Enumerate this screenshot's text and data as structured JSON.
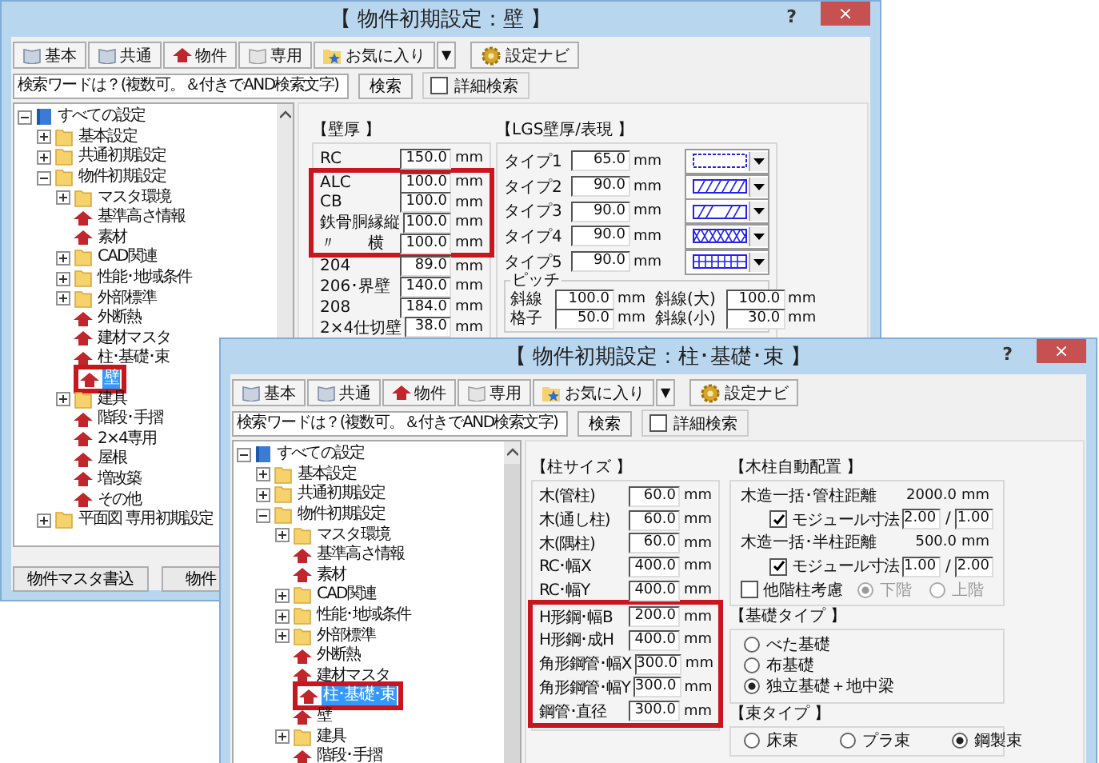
{
  "windows": [
    {
      "title": "【 物件初期設定：壁 】",
      "help": "?",
      "close": "×",
      "toolbar": [
        {
          "label": "基本"
        },
        {
          "label": "共通"
        },
        {
          "label": "物件"
        },
        {
          "label": "専用"
        },
        {
          "label": "お気に入り"
        },
        {
          "label": "▼"
        },
        {
          "label": "設定ナビ"
        }
      ],
      "search": {
        "value": "検索ワードは？(複数可。＆付きでAND検索文字)",
        "button": "検索",
        "detail": {
          "label": "詳細検索",
          "checked": false
        }
      },
      "tree": [
        {
          "label": "すべての設定",
          "kind": "root",
          "expanded": true,
          "selected": false,
          "highlighted": false,
          "children": [
            {
              "label": "基本設定",
              "kind": "folder",
              "expanded": false,
              "selected": false,
              "highlighted": false
            },
            {
              "label": "共通初期設定",
              "kind": "folder",
              "expanded": false,
              "selected": false,
              "highlighted": false
            },
            {
              "label": "物件初期設定",
              "kind": "folder",
              "expanded": true,
              "selected": false,
              "highlighted": false,
              "children": [
                {
                  "label": "マスタ環境",
                  "kind": "folder",
                  "expanded": false,
                  "selected": false,
                  "highlighted": false
                },
                {
                  "label": "基準高さ情報",
                  "kind": "page",
                  "selected": false,
                  "highlighted": false
                },
                {
                  "label": "素材",
                  "kind": "page",
                  "selected": false,
                  "highlighted": false
                },
                {
                  "label": "CAD関連",
                  "kind": "folder",
                  "expanded": false,
                  "selected": false,
                  "highlighted": false
                },
                {
                  "label": "性能･地域条件",
                  "kind": "folder",
                  "expanded": false,
                  "selected": false,
                  "highlighted": false
                },
                {
                  "label": "外部標準",
                  "kind": "folder",
                  "expanded": false,
                  "selected": false,
                  "highlighted": false
                },
                {
                  "label": "外断熱",
                  "kind": "page",
                  "selected": false,
                  "highlighted": false
                },
                {
                  "label": "建材マスタ",
                  "kind": "page",
                  "selected": false,
                  "highlighted": false
                },
                {
                  "label": "柱･基礎･束",
                  "kind": "page",
                  "selected": false,
                  "highlighted": false
                },
                {
                  "label": "壁",
                  "kind": "page",
                  "selected": true,
                  "highlighted": true
                },
                {
                  "label": "建具",
                  "kind": "folder",
                  "expanded": false,
                  "selected": false,
                  "highlighted": false
                },
                {
                  "label": "階段･手摺",
                  "kind": "page",
                  "selected": false,
                  "highlighted": false
                },
                {
                  "label": "2×4専用",
                  "kind": "page",
                  "selected": false,
                  "highlighted": false
                },
                {
                  "label": "屋根",
                  "kind": "page",
                  "selected": false,
                  "highlighted": false
                },
                {
                  "label": "増改築",
                  "kind": "page",
                  "selected": false,
                  "highlighted": false
                },
                {
                  "label": "その他",
                  "kind": "page",
                  "selected": false,
                  "highlighted": false
                }
              ]
            },
            {
              "label": "平面図 専用初期設定",
              "kind": "folder",
              "expanded": false,
              "selected": false,
              "highlighted": false
            }
          ]
        }
      ],
      "panel": {
        "kind": "wall",
        "wall": {
          "title": "【壁厚 】",
          "rows": [
            {
              "label": "RC",
              "value": "150.0",
              "unit": "mm",
              "highlighted": false
            },
            {
              "label": "ALC",
              "value": "100.0",
              "unit": "mm",
              "highlighted": true
            },
            {
              "label": "CB",
              "value": "100.0",
              "unit": "mm",
              "highlighted": true
            },
            {
              "label": "鉄骨胴縁縦",
              "value": "100.0",
              "unit": "mm",
              "highlighted": true
            },
            {
              "label": "〃　　横",
              "value": "100.0",
              "unit": "mm",
              "highlighted": true
            },
            {
              "label": "204",
              "value": "89.0",
              "unit": "mm",
              "highlighted": false
            },
            {
              "label": "206･界壁",
              "value": "140.0",
              "unit": "mm",
              "highlighted": false
            },
            {
              "label": "208",
              "value": "184.0",
              "unit": "mm",
              "highlighted": false
            },
            {
              "label": "2×4仕切壁",
              "value": "38.0",
              "unit": "mm",
              "highlighted": false
            }
          ]
        },
        "lgs": {
          "title": "【LGS壁厚/表現 】",
          "types": [
            {
              "label": "タイプ1",
              "value": "65.0",
              "unit": "mm"
            },
            {
              "label": "タイプ2",
              "value": "90.0",
              "unit": "mm"
            },
            {
              "label": "タイプ3",
              "value": "90.0",
              "unit": "mm"
            },
            {
              "label": "タイプ4",
              "value": "90.0",
              "unit": "mm"
            },
            {
              "label": "タイプ5",
              "value": "90.0",
              "unit": "mm"
            }
          ],
          "pitch": {
            "title": "ピッチ",
            "rows": [
              {
                "label": "斜線",
                "value": "100.0",
                "unit": "mm"
              },
              {
                "label": "斜線(大)",
                "value": "100.0",
                "unit": "mm"
              },
              {
                "label": "格子",
                "value": "50.0",
                "unit": "mm"
              },
              {
                "label": "斜線(小)",
                "value": "30.0",
                "unit": "mm"
              }
            ]
          }
        }
      },
      "footer_buttons": [
        "物件マスタ書込",
        "物件"
      ]
    },
    {
      "title": "【 物件初期設定 : 柱･基礎･束 】",
      "help": "?",
      "close": "×",
      "toolbar": [
        {
          "label": "基本"
        },
        {
          "label": "共通"
        },
        {
          "label": "物件"
        },
        {
          "label": "専用"
        },
        {
          "label": "お気に入り"
        },
        {
          "label": "▼"
        },
        {
          "label": "設定ナビ"
        }
      ],
      "search": {
        "value": "検索ワードは？(複数可。＆付きでAND検索文字)",
        "button": "検索",
        "detail": {
          "label": "詳細検索",
          "checked": false
        }
      },
      "tree": [
        {
          "label": "すべての設定",
          "kind": "root",
          "expanded": true,
          "selected": false,
          "highlighted": false,
          "children": [
            {
              "label": "基本設定",
              "kind": "folder",
              "expanded": false,
              "selected": false,
              "highlighted": false
            },
            {
              "label": "共通初期設定",
              "kind": "folder",
              "expanded": false,
              "selected": false,
              "highlighted": false
            },
            {
              "label": "物件初期設定",
              "kind": "folder",
              "expanded": true,
              "selected": false,
              "highlighted": false,
              "children": [
                {
                  "label": "マスタ環境",
                  "kind": "folder",
                  "expanded": false,
                  "selected": false,
                  "highlighted": false
                },
                {
                  "label": "基準高さ情報",
                  "kind": "page",
                  "selected": false,
                  "highlighted": false
                },
                {
                  "label": "素材",
                  "kind": "page",
                  "selected": false,
                  "highlighted": false
                },
                {
                  "label": "CAD関連",
                  "kind": "folder",
                  "expanded": false,
                  "selected": false,
                  "highlighted": false
                },
                {
                  "label": "性能･地域条件",
                  "kind": "folder",
                  "expanded": false,
                  "selected": false,
                  "highlighted": false
                },
                {
                  "label": "外部標準",
                  "kind": "folder",
                  "expanded": false,
                  "selected": false,
                  "highlighted": false
                },
                {
                  "label": "外断熱",
                  "kind": "page",
                  "selected": false,
                  "highlighted": false
                },
                {
                  "label": "建材マスタ",
                  "kind": "page",
                  "selected": false,
                  "highlighted": false
                },
                {
                  "label": "柱･基礎･束",
                  "kind": "page",
                  "selected": true,
                  "highlighted": true
                },
                {
                  "label": "壁",
                  "kind": "page",
                  "selected": false,
                  "highlighted": false
                },
                {
                  "label": "建具",
                  "kind": "folder",
                  "expanded": false,
                  "selected": false,
                  "highlighted": false
                },
                {
                  "label": "階段･手摺",
                  "kind": "page",
                  "selected": false,
                  "highlighted": false
                }
              ]
            }
          ]
        }
      ],
      "panel": {
        "kind": "column",
        "columns": {
          "title": "【柱サイズ 】",
          "rows": [
            {
              "label": "木(管柱)",
              "value": "60.0",
              "unit": "mm",
              "highlighted": false
            },
            {
              "label": "木(通し柱)",
              "value": "60.0",
              "unit": "mm",
              "highlighted": false
            },
            {
              "label": "木(隅柱)",
              "value": "60.0",
              "unit": "mm",
              "highlighted": false
            },
            {
              "label": "RC･幅X",
              "value": "400.0",
              "unit": "mm",
              "highlighted": false
            },
            {
              "label": "RC･幅Y",
              "value": "400.0",
              "unit": "mm",
              "highlighted": false
            },
            {
              "label": "H形鋼･幅B",
              "value": "200.0",
              "unit": "mm",
              "highlighted": true
            },
            {
              "label": "H形鋼･成H",
              "value": "400.0",
              "unit": "mm",
              "highlighted": true
            },
            {
              "label": "角形鋼管･幅X",
              "value": "300.0",
              "unit": "mm",
              "highlighted": true
            },
            {
              "label": "角形鋼管･幅Y",
              "value": "300.0",
              "unit": "mm",
              "highlighted": true
            },
            {
              "label": "鋼管･直径",
              "value": "300.0",
              "unit": "mm",
              "highlighted": true
            }
          ]
        },
        "auto": {
          "title": "【木柱自動配置 】",
          "rows": [
            {
              "label": "木造一括･管柱距離",
              "value": "2000.0",
              "unit": "mm",
              "module": {
                "label": "モジュール寸法",
                "checked": true,
                "a": "2.00",
                "sep": "/",
                "b": "1.00"
              }
            },
            {
              "label": "木造一括･半柱距離",
              "value": "500.0",
              "unit": "mm",
              "module": {
                "label": "モジュール寸法",
                "checked": true,
                "a": "1.00",
                "sep": "/",
                "b": "2.00"
              }
            }
          ],
          "other": {
            "label": "他階柱考慮",
            "checked": false,
            "options": [
              {
                "label": "下階",
                "selected": true,
                "disabled": true
              },
              {
                "label": "上階",
                "selected": false,
                "disabled": true
              }
            ]
          }
        },
        "foundation": {
          "title": "【基礎タイプ 】",
          "options": [
            {
              "label": "べた基礎",
              "selected": false
            },
            {
              "label": "布基礎",
              "selected": false
            },
            {
              "label": "独立基礎＋地中梁",
              "selected": true
            }
          ]
        },
        "strut": {
          "title": "【束タイプ 】",
          "options": [
            {
              "label": "床束",
              "selected": false
            },
            {
              "label": "プラ束",
              "selected": false
            },
            {
              "label": "鋼製束",
              "selected": true
            }
          ]
        }
      }
    }
  ]
}
